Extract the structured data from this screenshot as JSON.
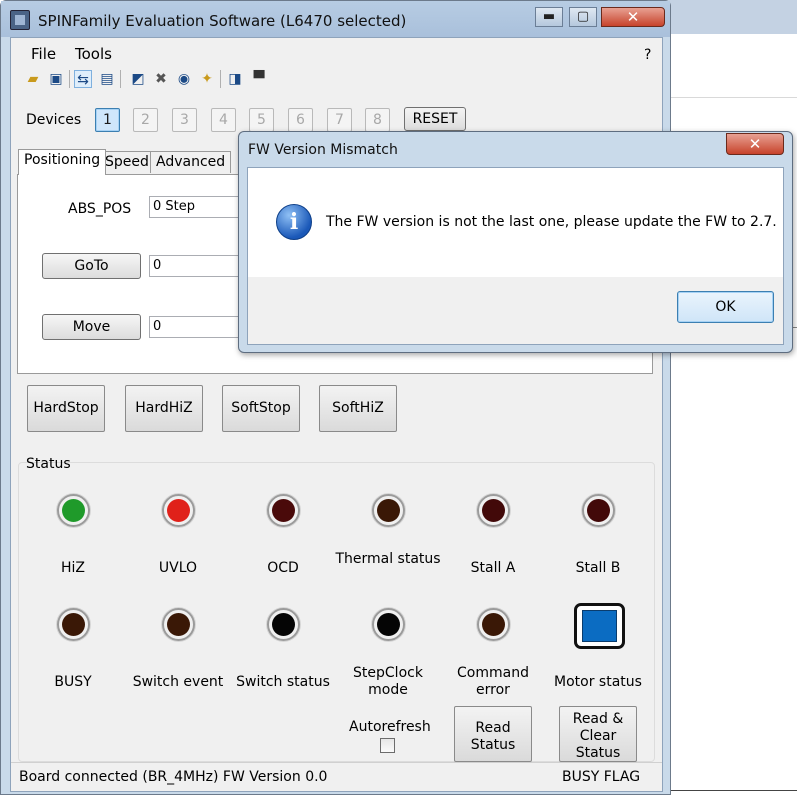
{
  "main_window": {
    "title": "SPINFamily Evaluation Software (L6470 selected)",
    "controls": {
      "minimize": "▬",
      "maximize": "▢",
      "close": "✕"
    }
  },
  "menu": {
    "file": "File",
    "tools": "Tools",
    "help": "?"
  },
  "toolbar": {
    "icons": [
      "open-folder",
      "save",
      "usb-connect",
      "book",
      "scope",
      "tools",
      "chip-v",
      "wand",
      "help",
      "terminal"
    ]
  },
  "devices": {
    "label": "Devices",
    "buttons": [
      "1",
      "2",
      "3",
      "4",
      "5",
      "6",
      "7",
      "8"
    ],
    "active": "1",
    "reset_label": "RESET"
  },
  "tabs": [
    "Positioning",
    "Speed",
    "Advanced"
  ],
  "positioning": {
    "abs_pos_label": "ABS_POS",
    "abs_pos_value": "0 Step",
    "goto_label": "GoTo",
    "goto_value": "0",
    "move_label": "Move",
    "move_value": "0"
  },
  "stop_buttons": [
    "HardStop",
    "HardHiZ",
    "SoftStop",
    "SoftHiZ"
  ],
  "status": {
    "label": "Status",
    "leds": [
      {
        "label": "HiZ",
        "color": "#1f9a2a"
      },
      {
        "label": "UVLO",
        "color": "#e0211a"
      },
      {
        "label": "OCD",
        "color": "#4a0a0a"
      },
      {
        "label": "Thermal status",
        "color": "#3a1806"
      },
      {
        "label": "Stall A",
        "color": "#420909"
      },
      {
        "label": "Stall B",
        "color": "#420909"
      },
      {
        "label": "BUSY",
        "color": "#3a1806"
      },
      {
        "label": "Switch event",
        "color": "#3a1806"
      },
      {
        "label": "Switch status",
        "color": "#050505"
      },
      {
        "label": "StepClock mode",
        "color": "#050505"
      },
      {
        "label": "Command error",
        "color": "#3a1806"
      },
      {
        "label": "Motor status",
        "color": "#0b6cc2"
      }
    ],
    "autorefresh_label": "Autorefresh",
    "read_status_label": "Read Status",
    "read_clear_label": "Read & Clear Status"
  },
  "statusbar": {
    "left": "Board connected (BR_4MHz)  FW Version 0.0",
    "right": "BUSY  FLAG"
  },
  "dialog": {
    "title": "FW Version Mismatch",
    "close": "✕",
    "message": "The FW version is not the last one, please update the FW to 2.7.",
    "ok_label": "OK"
  }
}
